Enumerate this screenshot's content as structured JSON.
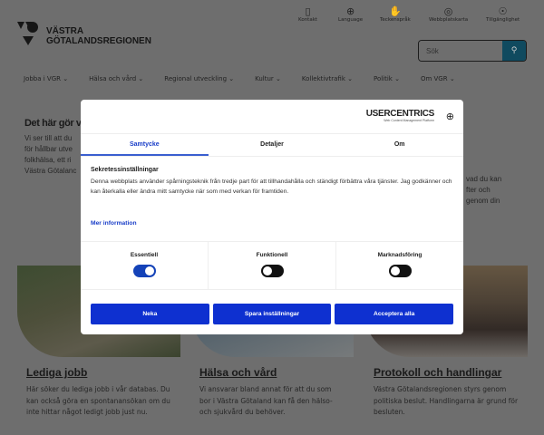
{
  "header": {
    "logo_line1": "VÄSTRA",
    "logo_line2": "GÖTALANDSREGIONEN",
    "utility": [
      {
        "icon": "phone-icon",
        "label": "Kontakt"
      },
      {
        "icon": "globe-icon",
        "label": "Language"
      },
      {
        "icon": "sign-language-icon",
        "label": "Teckenspråk"
      },
      {
        "icon": "compass-icon",
        "label": "Webbplatskarta"
      },
      {
        "icon": "accessibility-icon",
        "label": "Tillgänglighet"
      }
    ],
    "search_placeholder": "Sök",
    "nav": [
      "Jobba i VGR",
      "Hälsa och vård",
      "Regional utveckling",
      "Kultur",
      "Kollektivtrafik",
      "Politik",
      "Om VGR"
    ]
  },
  "intro": {
    "title": "Det här gör v",
    "lines": [
      "Vi ser till att du",
      "för hållbar utve",
      "folkhälsa, ett ri",
      "Västra Götalanc"
    ],
    "right_lines": [
      "vad du kan",
      "fter och",
      "genom din"
    ]
  },
  "cards": [
    {
      "title": "Lediga jobb",
      "desc": "Här söker du lediga jobb i vår databas. Du kan också göra en spontanansökan om du inte hittar något ledigt jobb just nu."
    },
    {
      "title": "Hälsa och vård",
      "desc": "Vi ansvarar bland annat för att du som bor i Västra Götaland kan få den hälso- och sjukvård du behöver."
    },
    {
      "title": "Protokoll och handlingar",
      "desc": "Västra Götalandsregionen styrs genom politiska beslut. Handlingarna är grund för besluten."
    }
  ],
  "consent": {
    "brand": "USERCENTRICS",
    "brand_sub": "Web Content Management Platform",
    "tabs": [
      "Samtycke",
      "Detaljer",
      "Om"
    ],
    "title": "Sekretessinställningar",
    "text": "Denna webbplats använder spårningsteknik från tredje part för att tillhandahålla och ständigt förbättra våra tjänster. Jag godkänner och kan återkalla eller ändra mitt samtycke när som med verkan för framtiden.",
    "more": "Mer information",
    "toggles": [
      {
        "label": "Essentiell",
        "on": true
      },
      {
        "label": "Funktionell",
        "on": false
      },
      {
        "label": "Marknadsföring",
        "on": false
      }
    ],
    "buttons": {
      "deny": "Neka",
      "save": "Spara inställningar",
      "accept": "Acceptera alla"
    },
    "accent": "#0e30d0"
  }
}
